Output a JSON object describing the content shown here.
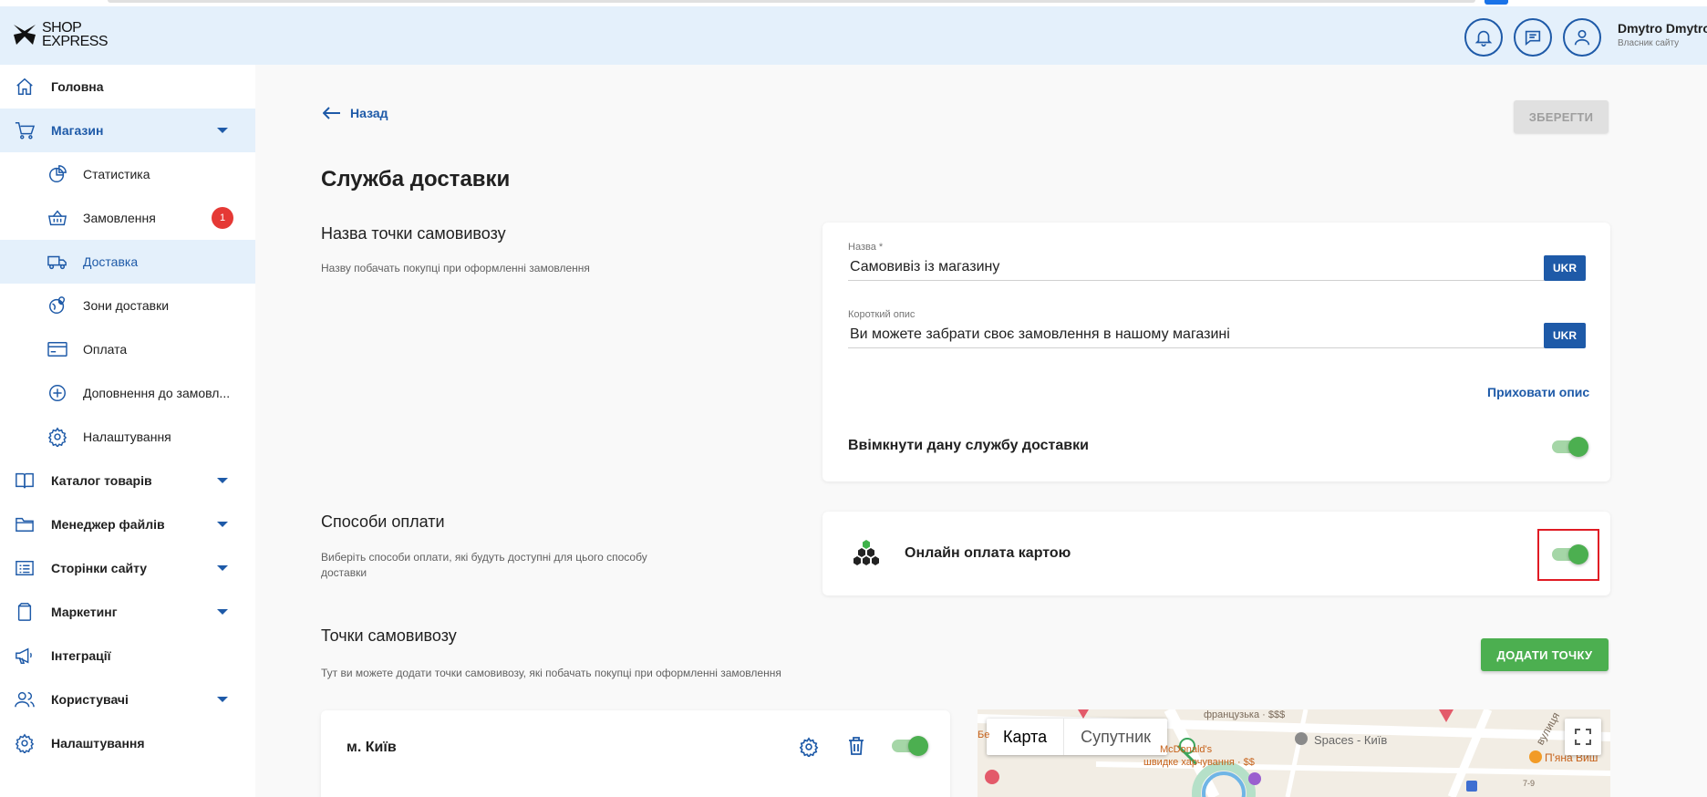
{
  "header": {
    "logo_line1": "SHOP",
    "logo_line2": "EXPRESS",
    "user_name": "Dmytro Dmytro",
    "user_role": "Власник сайту"
  },
  "sidebar": {
    "items": [
      {
        "label": "Головна",
        "icon": "home-icon"
      },
      {
        "label": "Магазин",
        "icon": "cart-icon"
      },
      {
        "label": "Статистика",
        "icon": "pie-chart-icon"
      },
      {
        "label": "Замовлення",
        "icon": "basket-icon",
        "badge": "1"
      },
      {
        "label": "Доставка",
        "icon": "truck-icon"
      },
      {
        "label": "Зони доставки",
        "icon": "globe-pin-icon"
      },
      {
        "label": "Оплата",
        "icon": "credit-card-icon"
      },
      {
        "label": "Доповнення до замовл...",
        "icon": "plus-circle-icon"
      },
      {
        "label": "Налаштування",
        "icon": "gear-icon"
      },
      {
        "label": "Каталог товарів",
        "icon": "book-icon"
      },
      {
        "label": "Менеджер файлів",
        "icon": "folder-icon"
      },
      {
        "label": "Сторінки сайту",
        "icon": "page-list-icon"
      },
      {
        "label": "Маркетинг",
        "icon": "shopping-bag-icon"
      },
      {
        "label": "Інтеграції",
        "icon": "megaphone-icon"
      },
      {
        "label": "Користувачі",
        "icon": "users-icon"
      },
      {
        "label": "Налаштування",
        "icon": "gear-icon"
      }
    ]
  },
  "main": {
    "back_label": "Назад",
    "save_label": "ЗБЕРЕГТИ",
    "page_title": "Служба доставки",
    "pickup_name_section": {
      "title": "Назва точки самовивозу",
      "description": "Назву побачать покупці при оформленні замовлення"
    },
    "name_field": {
      "label": "Назва *",
      "value": "Самовивіз із магазину",
      "lang": "UKR"
    },
    "desc_field": {
      "label": "Короткий опис",
      "value": "Ви можете забрати своє замовлення в нашому магазині",
      "lang": "UKR"
    },
    "hide_desc_link": "Приховати опис",
    "enable_label": "Ввімкнути дану службу доставки",
    "payment_section": {
      "title": "Способи оплати",
      "description": "Виберіть способи оплати, які будуть доступні для цього способу доставки"
    },
    "payment_method_label": "Онлайн оплата картою",
    "points_section": {
      "title": "Точки самовивозу",
      "description": "Тут ви можете додати точки самовивозу, які побачать покупці при оформленні замовлення"
    },
    "add_point_label": "ДОДАТИ ТОЧКУ",
    "point_city": "м. Київ"
  },
  "map": {
    "tab_map": "Карта",
    "tab_satellite": "Супутник",
    "labels": {
      "french": "французька · $$$",
      "spaces": "Spaces - Київ",
      "street": "вулиця",
      "mcd1": "McDonald's",
      "mcd2": "швидке харчування · $$",
      "pub": "П'яна Виш",
      "num": "7-9",
      "se": "Бе"
    }
  },
  "colors": {
    "accent": "#1e5aa8",
    "header_bg": "#e4f0fb",
    "toggle_on": "#4caf50",
    "badge": "#e53935",
    "highlight": "#e01b24"
  }
}
